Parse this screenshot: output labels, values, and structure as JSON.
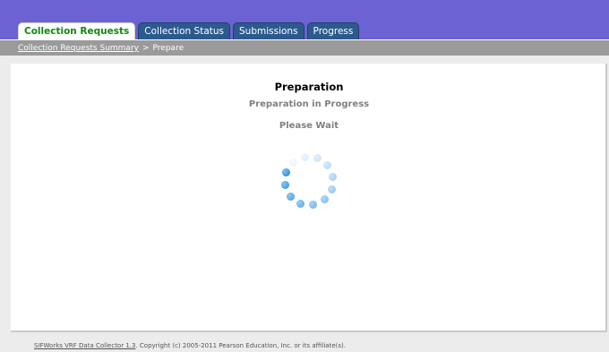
{
  "tabs": [
    {
      "label": "Collection Requests",
      "active": true
    },
    {
      "label": "Collection Status",
      "active": false
    },
    {
      "label": "Submissions",
      "active": false
    },
    {
      "label": "Progress",
      "active": false
    }
  ],
  "breadcrumb": {
    "link": "Collection Requests Summary",
    "separator": ">",
    "current": "Prepare"
  },
  "content": {
    "title": "Preparation",
    "subtitle": "Preparation in Progress",
    "wait_text": "Please Wait"
  },
  "spinner": {
    "icon": "loading-spinner-icon",
    "dot_count": 12
  },
  "footer": {
    "product_link": "SIFWorks VRF Data Collector 1.3",
    "copyright": ". Copyright (c) 2005-2011 Pearson Education, Inc. or its affiliate(s)."
  },
  "colors": {
    "header": "#6b62d3",
    "tab": "#2d5a8e",
    "active_tab_text": "#0d8a0d",
    "spinner": "#1a7fd4"
  }
}
